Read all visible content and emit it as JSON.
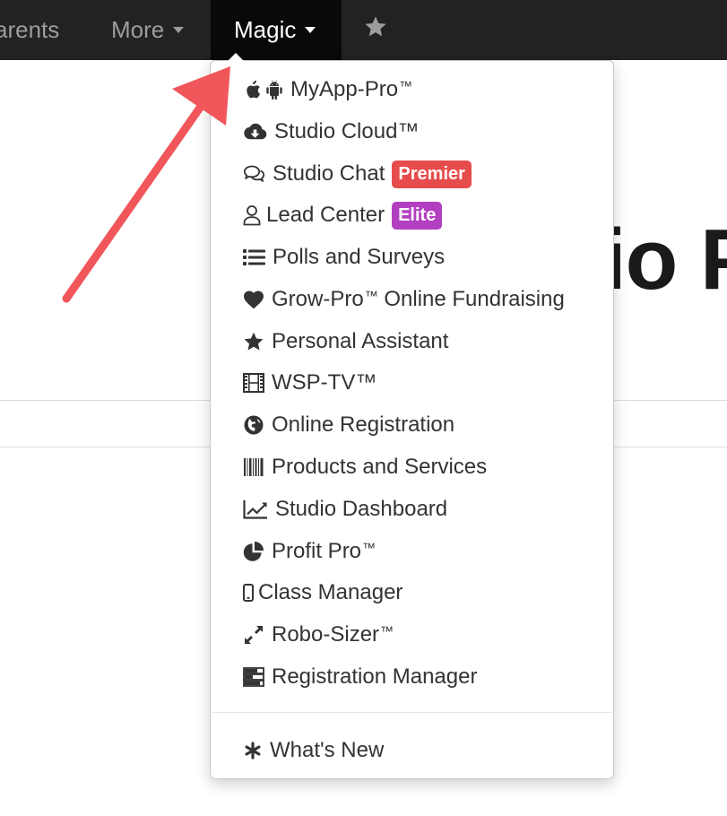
{
  "nav": {
    "parents_label": "arents",
    "more_label": "More",
    "magic_label": "Magic"
  },
  "page": {
    "title_fragment": "io P"
  },
  "menu": {
    "items": [
      {
        "label": "MyApp-Pro",
        "tm": "™",
        "icon": "apple-icon, android-icon"
      },
      {
        "label": "Studio Cloud™",
        "icon": "cloud-download-icon"
      },
      {
        "label": "Studio Chat",
        "badge": "Premier",
        "badge_color": "#e74c4c",
        "icon": "chat-bubbles-icon"
      },
      {
        "label": "Lead Center",
        "badge": "Elite",
        "badge_color": "#b23fbf",
        "icon": "user-outline-icon"
      },
      {
        "label": "Polls and Surveys",
        "icon": "list-icon"
      },
      {
        "label": "Grow-Pro",
        "tm": "™",
        "suffix": " Online Fundraising",
        "icon": "heart-icon"
      },
      {
        "label": "Personal Assistant",
        "icon": "star-icon"
      },
      {
        "label": "WSP-TV™",
        "icon": "film-icon"
      },
      {
        "label": "Online Registration",
        "icon": "globe-icon"
      },
      {
        "label": "Products and Services",
        "icon": "barcode-icon"
      },
      {
        "label": "Studio Dashboard",
        "icon": "line-chart-icon"
      },
      {
        "label": "Profit Pro",
        "tm": "™",
        "icon": "pie-chart-icon"
      },
      {
        "label": "Class Manager",
        "icon": "mobile-icon"
      },
      {
        "label": "Robo-Sizer",
        "tm": "™",
        "icon": "resize-icon"
      },
      {
        "label": "Registration Manager",
        "icon": "tasks-icon"
      },
      {
        "label": "What's New",
        "icon": "asterisk-icon"
      }
    ]
  },
  "colors": {
    "navbar": "#222222",
    "active_tab": "#090909",
    "arrow": "#f0565a",
    "premier_badge": "#e74c4c",
    "elite_badge": "#b23fbf"
  }
}
